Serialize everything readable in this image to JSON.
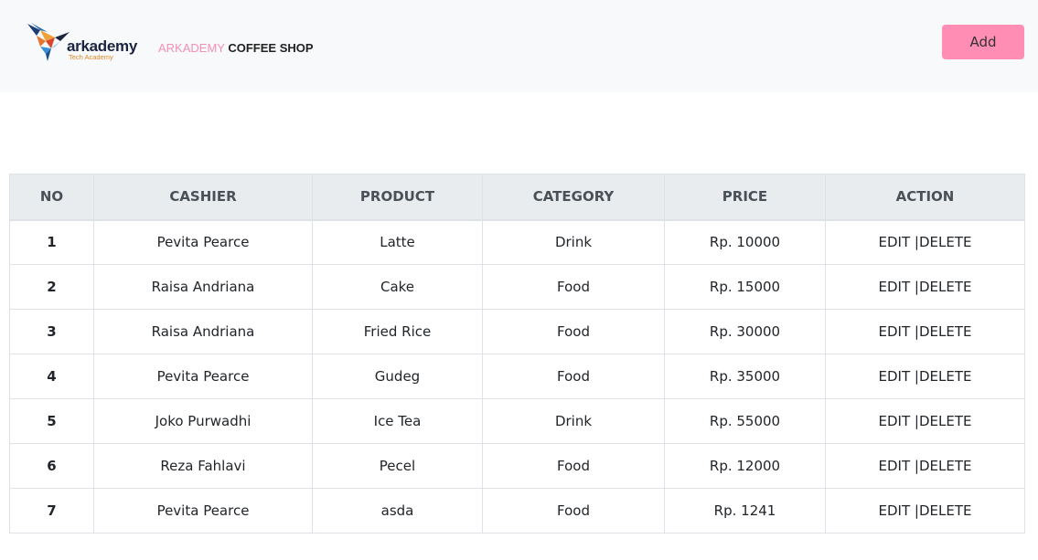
{
  "header": {
    "logo": {
      "word": "arkademy",
      "sub": "Tech Academy"
    },
    "title_pink": "ARKADEMY",
    "title_dark": "COFFEE SHOP",
    "add_label": "Add"
  },
  "colors": {
    "navbar_bg": "#f8f9fa",
    "add_button": "#ff8db4",
    "title_pink": "#f48fb1",
    "table_head_bg": "#e9ecef"
  },
  "table": {
    "columns": [
      "NO",
      "CASHIER",
      "PRODUCT",
      "CATEGORY",
      "PRICE",
      "ACTION"
    ],
    "rows": [
      {
        "no": "1",
        "cashier": "Pevita Pearce",
        "product": "Latte",
        "category": "Drink",
        "price": "Rp. 10000",
        "edit": "EDIT",
        "sep": " |",
        "delete": "DELETE"
      },
      {
        "no": "2",
        "cashier": "Raisa Andriana",
        "product": "Cake",
        "category": "Food",
        "price": "Rp. 15000",
        "edit": "EDIT",
        "sep": " |",
        "delete": "DELETE"
      },
      {
        "no": "3",
        "cashier": "Raisa Andriana",
        "product": "Fried Rice",
        "category": "Food",
        "price": "Rp. 30000",
        "edit": "EDIT",
        "sep": " |",
        "delete": "DELETE"
      },
      {
        "no": "4",
        "cashier": "Pevita Pearce",
        "product": "Gudeg",
        "category": "Food",
        "price": "Rp. 35000",
        "edit": "EDIT",
        "sep": " |",
        "delete": "DELETE"
      },
      {
        "no": "5",
        "cashier": "Joko Purwadhi",
        "product": "Ice Tea",
        "category": "Drink",
        "price": "Rp. 55000",
        "edit": "EDIT",
        "sep": " |",
        "delete": "DELETE"
      },
      {
        "no": "6",
        "cashier": "Reza Fahlavi",
        "product": "Pecel",
        "category": "Food",
        "price": "Rp. 12000",
        "edit": "EDIT",
        "sep": " |",
        "delete": "DELETE"
      },
      {
        "no": "7",
        "cashier": "Pevita Pearce",
        "product": "asda",
        "category": "Food",
        "price": "Rp. 1241",
        "edit": "EDIT",
        "sep": " |",
        "delete": "DELETE"
      }
    ]
  }
}
